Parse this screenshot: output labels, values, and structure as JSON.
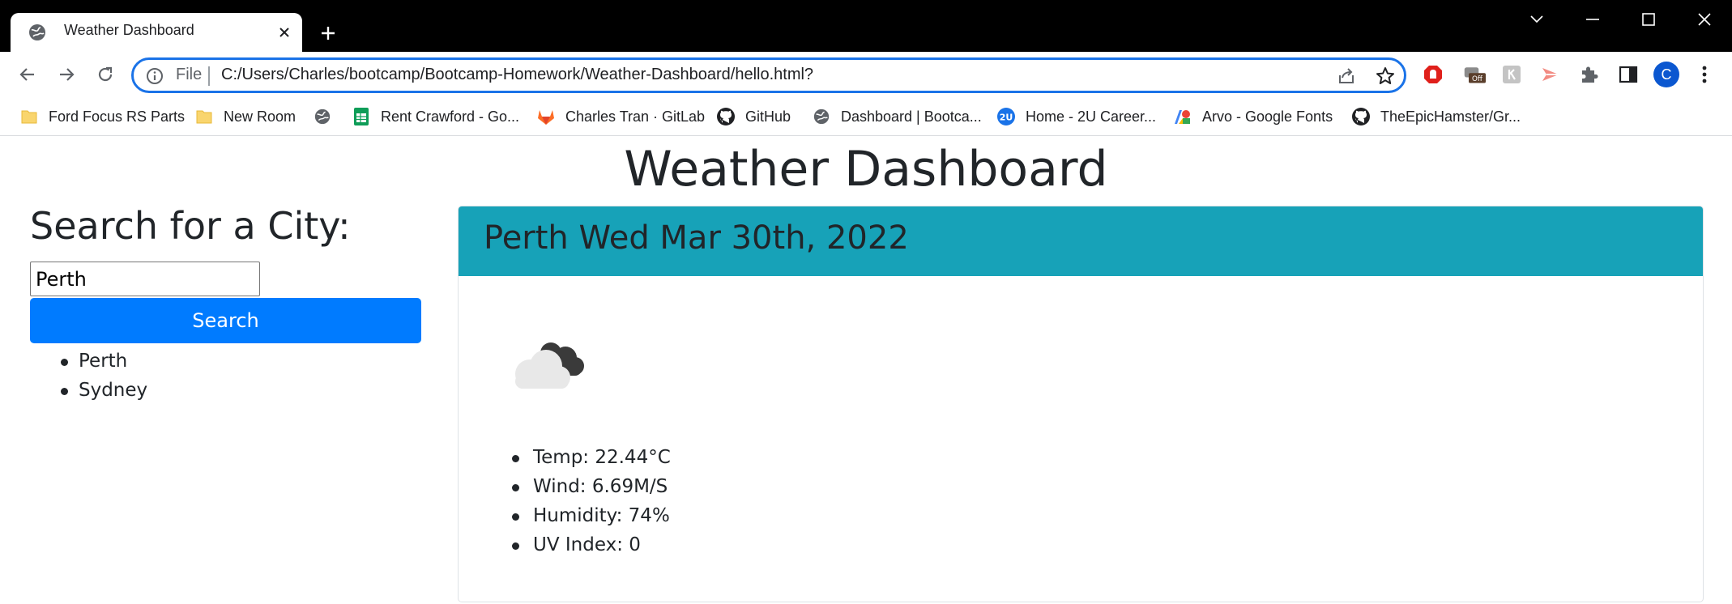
{
  "browser": {
    "tab": {
      "title": "Weather Dashboard",
      "favicon": "globe-icon"
    },
    "omnibox": {
      "scheme_label": "File",
      "url": "C:/Users/Charles/bootcamp/Bootcamp-Homework/Weather-Dashboard/hello.html?"
    },
    "profile_initial": "C",
    "extensions": [
      "adblock-icon",
      "off-extension-icon",
      "grey-extension-icon",
      "screencastify-icon",
      "puzzle-icon",
      "side-panel-icon"
    ],
    "bookmarks": [
      {
        "label": "Ford Focus RS Parts",
        "icon": "folder-icon"
      },
      {
        "label": "New Room",
        "icon": "folder-icon"
      },
      {
        "label": "",
        "icon": "globe-icon"
      },
      {
        "label": "Rent Crawford - Go...",
        "icon": "sheets-icon"
      },
      {
        "label": "Charles Tran · GitLab",
        "icon": "gitlab-icon"
      },
      {
        "label": "GitHub",
        "icon": "github-icon"
      },
      {
        "label": "Dashboard | Bootca...",
        "icon": "globe-icon"
      },
      {
        "label": "Home - 2U Career...",
        "icon": "2u-icon"
      },
      {
        "label": "Arvo - Google Fonts",
        "icon": "google-fonts-icon"
      },
      {
        "label": "TheEpicHamster/Gr...",
        "icon": "github-icon"
      }
    ]
  },
  "page": {
    "title": "Weather Dashboard",
    "search": {
      "heading": "Search for a City:",
      "input_value": "Perth",
      "button_label": "Search",
      "history": [
        "Perth",
        "Sydney"
      ]
    },
    "current": {
      "heading": "Perth Wed Mar 30th, 2022",
      "icon": "cloudy-icon",
      "stats": [
        "Temp: 22.44°C",
        "Wind: 6.69M/S",
        "Humidity: 74%",
        "UV Index: 0"
      ]
    }
  },
  "colors": {
    "card_header": "#17a2b8",
    "search_button": "#007bff",
    "omnibox_border": "#1a73e8"
  }
}
